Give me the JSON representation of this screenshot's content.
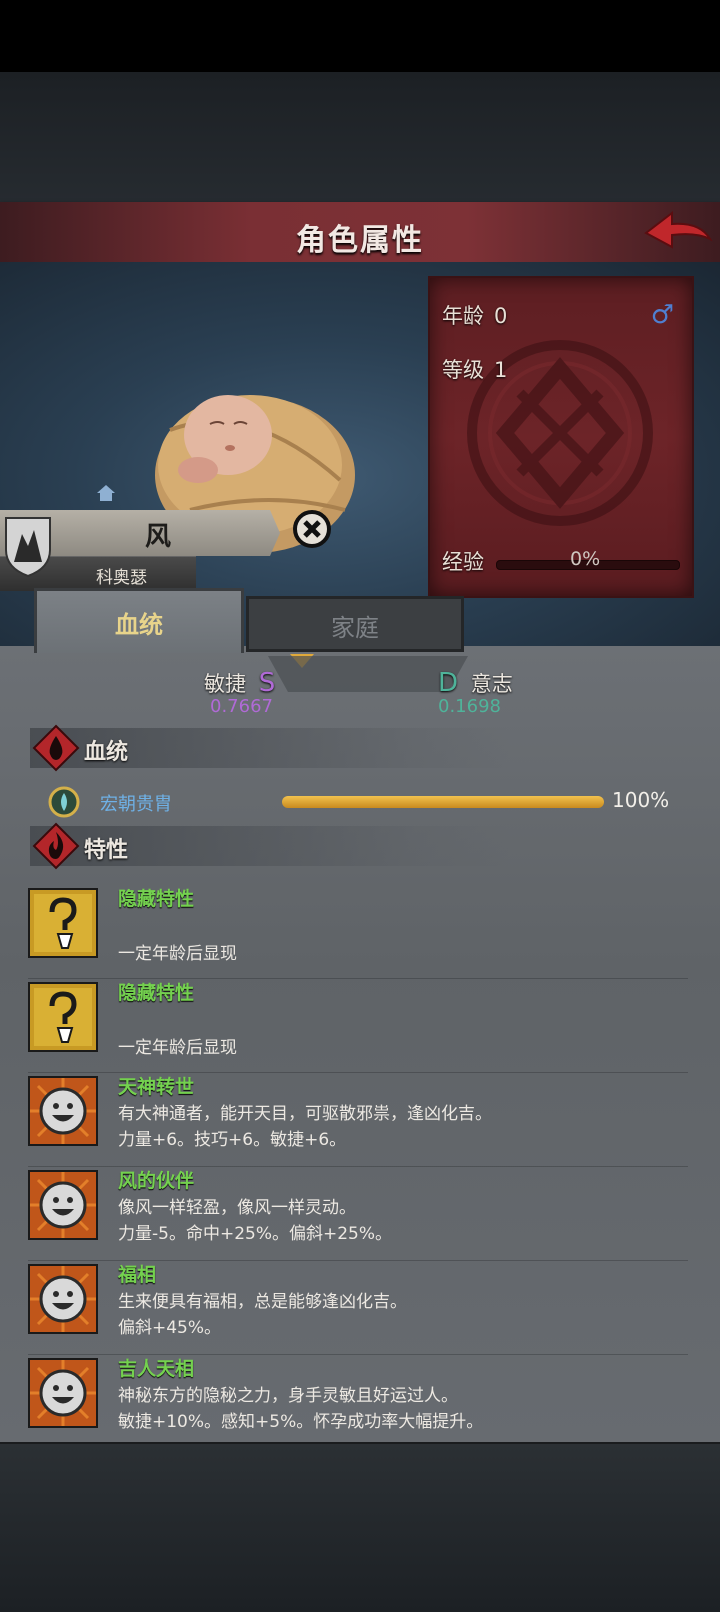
{
  "header": {
    "title": "角色属性"
  },
  "character": {
    "name": "风",
    "family_name": "科奥瑟",
    "gender_symbol": "♂"
  },
  "stats": {
    "age_label": "年龄",
    "age_value": "0",
    "level_label": "等级",
    "level_value": "1",
    "exp_label": "经验",
    "exp_value": "0%",
    "exp_progress": 0
  },
  "tabs": [
    {
      "label": "血统",
      "active": true
    },
    {
      "label": "家庭",
      "active": false
    }
  ],
  "attributes": {
    "left": {
      "name": "敏捷",
      "grade": "S",
      "value": "0.7667",
      "color": "#b06ad6"
    },
    "right": {
      "name": "意志",
      "grade": "D",
      "value": "0.1698",
      "color": "#4fb39a"
    }
  },
  "bloodline_section": {
    "title": "血统",
    "entries": [
      {
        "name": "宏朝贵胄",
        "percent": "100%",
        "progress": 1.0
      }
    ]
  },
  "traits_section": {
    "title": "特性",
    "items": [
      {
        "icon": "question-mark-icon",
        "name": "隐藏特性",
        "desc1": "一定年龄后显现",
        "desc2": ""
      },
      {
        "icon": "question-mark-icon",
        "name": "隐藏特性",
        "desc1": "一定年龄后显现",
        "desc2": ""
      },
      {
        "icon": "smiley-face-icon",
        "name": "天神转世",
        "desc1": "有大神通者，能开天目，可驱散邪祟，逢凶化吉。",
        "desc2": "力量+6。技巧+6。敏捷+6。"
      },
      {
        "icon": "smiley-face-icon",
        "name": "风的伙伴",
        "desc1": "像风一样轻盈，像风一样灵动。",
        "desc2": "力量-5。命中+25%。偏斜+25%。"
      },
      {
        "icon": "smiley-face-icon",
        "name": "福相",
        "desc1": "生来便具有福相，总是能够逢凶化吉。",
        "desc2": "偏斜+45%。"
      },
      {
        "icon": "smiley-face-icon",
        "name": "吉人天相",
        "desc1": "神秘东方的隐秘之力，身手灵敏且好运过人。",
        "desc2": "敏捷+10%。感知+5%。怀孕成功率大幅提升。"
      }
    ]
  }
}
